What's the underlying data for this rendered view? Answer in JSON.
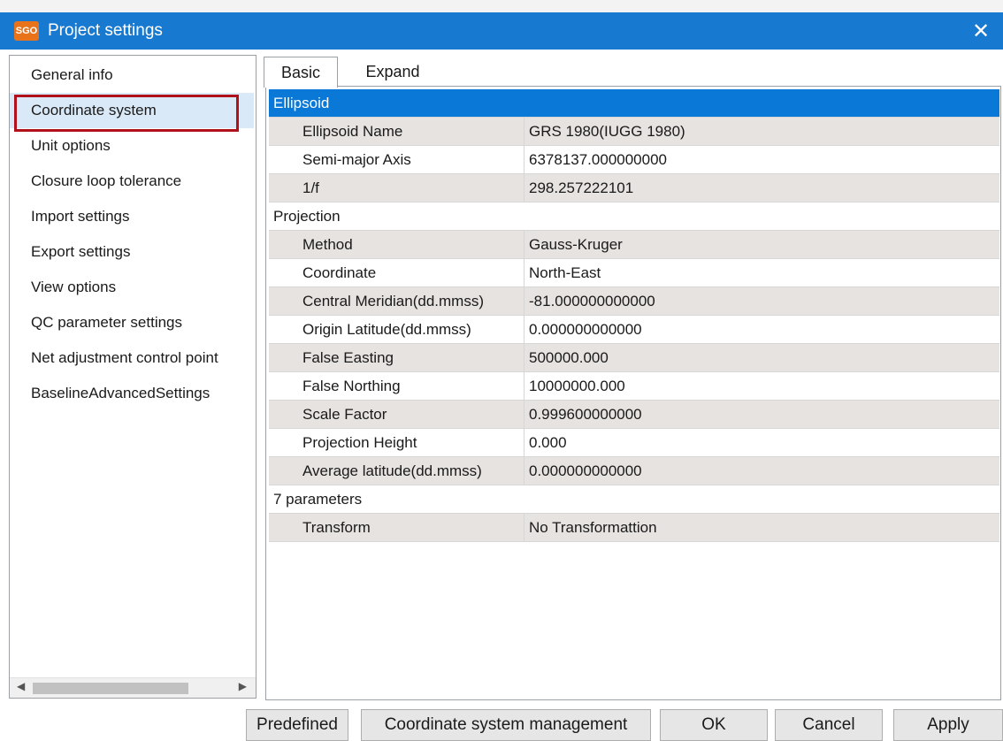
{
  "window": {
    "app_badge": "SGO",
    "title": "Project settings",
    "close_glyph": "✕"
  },
  "sidebar": {
    "items": [
      {
        "label": "General info"
      },
      {
        "label": "Coordinate system",
        "selected": true
      },
      {
        "label": "Unit options"
      },
      {
        "label": "Closure loop tolerance"
      },
      {
        "label": "Import settings"
      },
      {
        "label": "Export settings"
      },
      {
        "label": "View options"
      },
      {
        "label": "QC parameter settings"
      },
      {
        "label": "Net adjustment control point"
      },
      {
        "label": "BaselineAdvancedSettings"
      }
    ]
  },
  "tabs": [
    {
      "label": "Basic",
      "active": true
    },
    {
      "label": "Expand",
      "active": false
    }
  ],
  "grid": {
    "ellipsoid": {
      "title": "Ellipsoid",
      "rows": [
        {
          "label": "Ellipsoid Name",
          "value": "GRS 1980(IUGG 1980)"
        },
        {
          "label": "Semi-major Axis",
          "value": "6378137.000000000"
        },
        {
          "label": "1/f",
          "value": "298.257222101"
        }
      ]
    },
    "projection": {
      "title": "Projection",
      "rows": [
        {
          "label": "Method",
          "value": "Gauss-Kruger"
        },
        {
          "label": "Coordinate",
          "value": "North-East"
        },
        {
          "label": "Central Meridian(dd.mmss)",
          "value": "-81.000000000000"
        },
        {
          "label": "Origin Latitude(dd.mmss)",
          "value": "0.000000000000"
        },
        {
          "label": "False Easting",
          "value": "500000.000"
        },
        {
          "label": "False Northing",
          "value": "10000000.000"
        },
        {
          "label": "Scale Factor",
          "value": "0.999600000000"
        },
        {
          "label": "Projection Height",
          "value": "0.000"
        },
        {
          "label": "Average latitude(dd.mmss)",
          "value": "0.000000000000"
        }
      ]
    },
    "seven_params": {
      "title": "7 parameters",
      "rows": [
        {
          "label": "Transform",
          "value": "No Transformattion"
        }
      ]
    }
  },
  "buttons": {
    "predefined": "Predefined",
    "coord_mgmt": "Coordinate system management",
    "ok": "OK",
    "cancel": "Cancel",
    "apply": "Apply"
  },
  "colors": {
    "titlebar": "#1879d0",
    "selected_category": "#0a78d7",
    "sidebar_selected": "#d9e9f8",
    "highlight_border": "#b0111a",
    "shaded_row": "#e6e3e1"
  }
}
